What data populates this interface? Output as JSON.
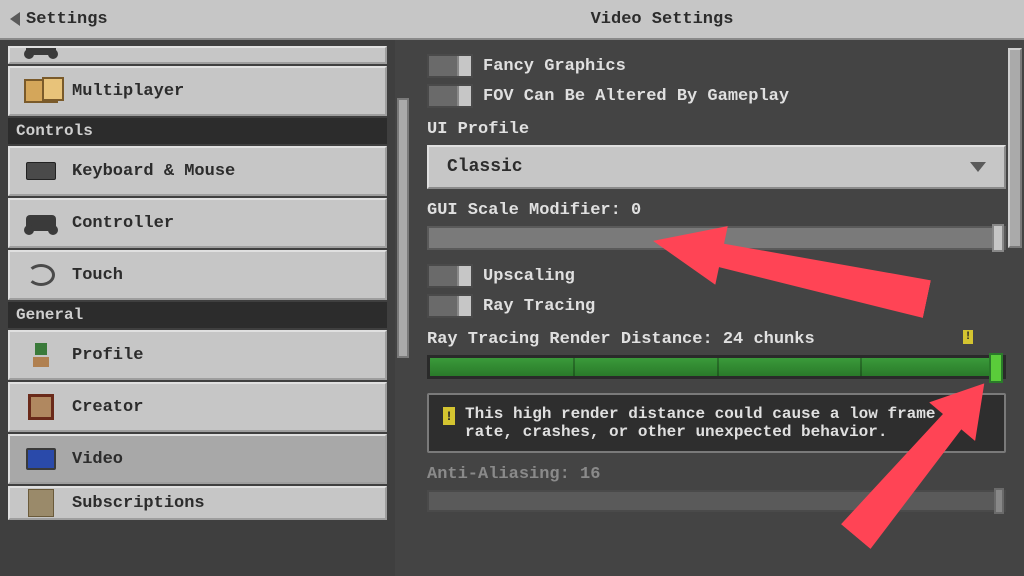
{
  "header": {
    "back": "Settings",
    "title": "Video Settings"
  },
  "sidebar": {
    "multiplayer": "Multiplayer",
    "section_controls": "Controls",
    "keyboard": "Keyboard & Mouse",
    "controller": "Controller",
    "touch": "Touch",
    "section_general": "General",
    "profile": "Profile",
    "creator": "Creator",
    "video": "Video",
    "subscriptions": "Subscriptions"
  },
  "right": {
    "fancy": "Fancy Graphics",
    "fov": "FOV Can Be Altered By Gameplay",
    "ui_profile_label": "UI Profile",
    "ui_profile_value": "Classic",
    "gui_scale": "GUI Scale Modifier: 0",
    "upscaling": "Upscaling",
    "raytracing": "Ray Tracing",
    "rt_distance": "Ray Tracing Render Distance: 24 chunks",
    "warning": "This high render distance could cause a low frame rate, crashes, or other unexpected behavior.",
    "aa": "Anti-Aliasing: 16"
  }
}
